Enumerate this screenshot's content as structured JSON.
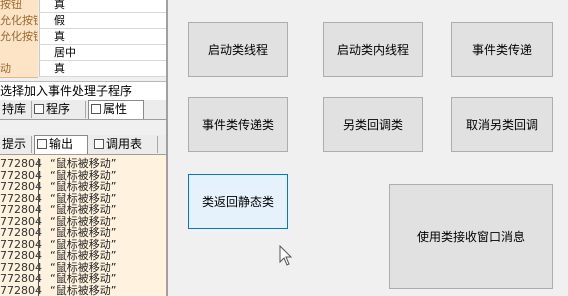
{
  "properties": [
    {
      "name": "按钮",
      "value": "真"
    },
    {
      "name": "允化按钮",
      "value": "假"
    },
    {
      "name": "允化按钮",
      "value": "真"
    },
    {
      "name": "",
      "value": "居中"
    },
    {
      "name": "动",
      "value": "真"
    }
  ],
  "hint_text": "选择加入事件处理子程序",
  "top_tabs": [
    {
      "label": "持库",
      "icon": ""
    },
    {
      "label": "程序",
      "icon": "program-icon"
    },
    {
      "label": "属性",
      "icon": "property-icon"
    }
  ],
  "bottom_tabs": [
    {
      "label": "提示",
      "icon": ""
    },
    {
      "label": "输出",
      "icon": "output-icon"
    },
    {
      "label": "调用表",
      "icon": "call-table-icon"
    }
  ],
  "output_rows": [
    {
      "id": "772804",
      "value": "“鼠标被移动”"
    },
    {
      "id": "772804",
      "value": "“鼠标被移动”"
    },
    {
      "id": "772804",
      "value": "“鼠标被移动”"
    },
    {
      "id": "772804",
      "value": "“鼠标被移动”"
    },
    {
      "id": "772804",
      "value": "“鼠标被移动”"
    },
    {
      "id": "772804",
      "value": "“鼠标被移动”"
    },
    {
      "id": "772804",
      "value": "“鼠标被移动”"
    },
    {
      "id": "772804",
      "value": "“鼠标被移动”"
    },
    {
      "id": "772804",
      "value": "“鼠标被移动”"
    },
    {
      "id": "772804",
      "value": "“鼠标被移动”"
    },
    {
      "id": "772804",
      "value": "“鼠标被移动”"
    },
    {
      "id": "772804",
      "value": "“鼠标被移动”"
    }
  ],
  "buttons": {
    "start_thread": "启动类线程",
    "start_inner_thread": "启动类内线程",
    "event_pass": "事件类传递",
    "event_pass_class": "事件类传递类",
    "other_callback": "另类回调类",
    "cancel_other_callback": "取消另类回调",
    "callback_static": "类返回静态类",
    "receive_window_msg": "使用类接收窗口消息"
  },
  "colors": {
    "prop_name_bg": "#fde4c6",
    "output_bg": "#fff3e0",
    "button_bg": "#e1e1e1",
    "focus_border": "#0078d7"
  }
}
